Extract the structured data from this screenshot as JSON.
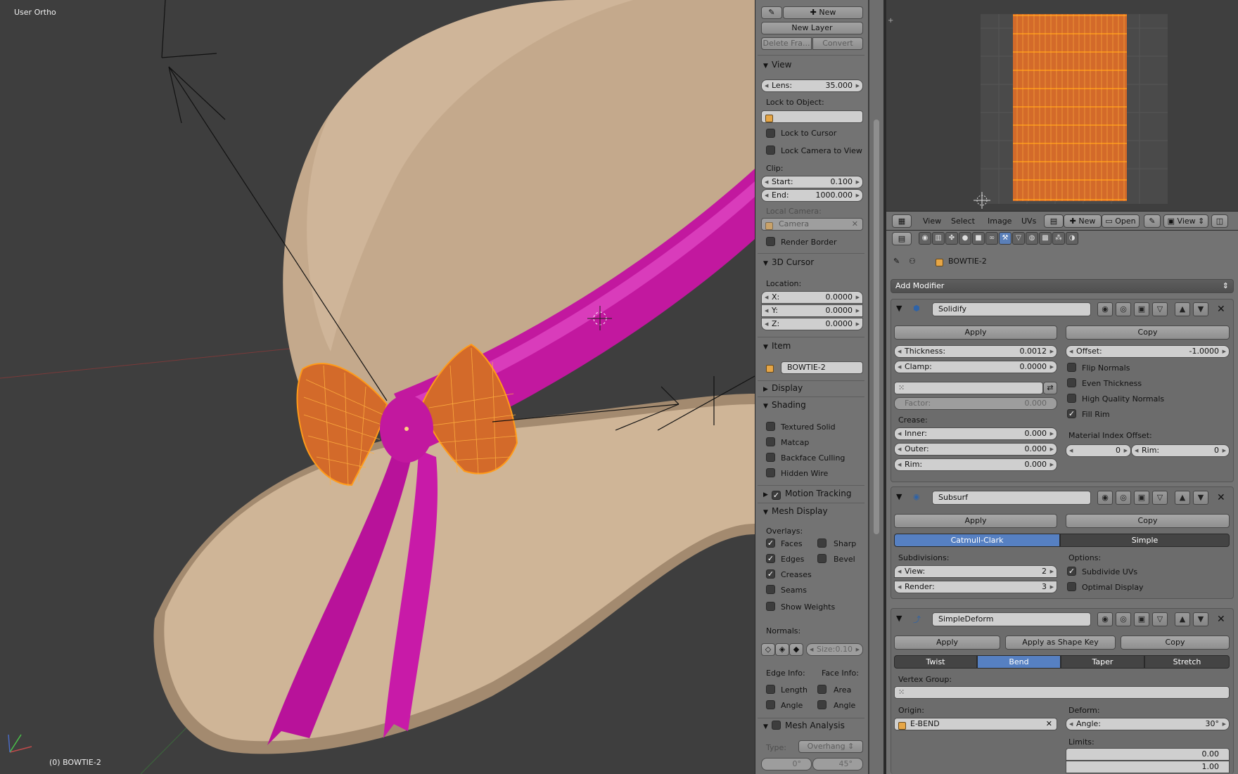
{
  "viewport": {
    "view_name": "User Ortho",
    "object_status": "(0) BOWTIE-2",
    "colors": {
      "hat": "#c7ac8f",
      "ribbon": "#c815a6",
      "wire": "#ff9b1a",
      "bg": "#3e3e3e"
    }
  },
  "npanel": {
    "grease_pencil": {
      "new_label": "New",
      "new_layer_label": "New Layer",
      "delete_frame_label": "Delete Fra...",
      "convert_label": "Convert"
    },
    "view": {
      "header": "View",
      "lens_label": "Lens:",
      "lens_value": "35.000",
      "lock_to_object_label": "Lock to Object:",
      "lock_to_cursor_label": "Lock to Cursor",
      "lock_camera_label": "Lock Camera to View",
      "clip_label": "Clip:",
      "clip_start_label": "Start:",
      "clip_start_value": "0.100",
      "clip_end_label": "End:",
      "clip_end_value": "1000.000",
      "local_camera_label": "Local Camera:",
      "camera_placeholder": "Camera",
      "render_border_label": "Render Border"
    },
    "cursor": {
      "header": "3D Cursor",
      "location_label": "Location:",
      "x_label": "X:",
      "x_value": "0.0000",
      "y_label": "Y:",
      "y_value": "0.0000",
      "z_label": "Z:",
      "z_value": "0.0000"
    },
    "item": {
      "header": "Item",
      "name": "BOWTIE-2"
    },
    "display": {
      "header": "Display"
    },
    "shading": {
      "header": "Shading",
      "textured_solid": "Textured Solid",
      "matcap": "Matcap",
      "backface_culling": "Backface Culling",
      "hidden_wire": "Hidden Wire"
    },
    "motion_tracking": {
      "header": "Motion Tracking"
    },
    "mesh_display": {
      "header": "Mesh Display",
      "overlays_label": "Overlays:",
      "faces": "Faces",
      "sharp": "Sharp",
      "edges": "Edges",
      "bevel": "Bevel",
      "creases": "Creases",
      "seams": "Seams",
      "show_weights": "Show Weights",
      "normals_label": "Normals:",
      "size_label": "Size:",
      "size_value": "0.10",
      "edge_info_label": "Edge Info:",
      "face_info_label": "Face Info:",
      "length": "Length",
      "area": "Area",
      "edge_angle": "Angle",
      "face_angle": "Angle"
    },
    "mesh_analysis": {
      "header": "Mesh Analysis",
      "type_label": "Type:",
      "type_value": "Overhang",
      "min_value": "0°",
      "max_value": "45°"
    }
  },
  "uv_header": {
    "menu_view": "View",
    "menu_select": "Select",
    "menu_image": "Image",
    "menu_uvs": "UVs",
    "new_label": "New",
    "open_label": "Open",
    "view_label": "View"
  },
  "properties": {
    "object_name": "BOWTIE-2",
    "add_modifier_label": "Add Modifier",
    "solidify": {
      "name": "Solidify",
      "apply_label": "Apply",
      "copy_label": "Copy",
      "thickness_label": "Thickness:",
      "thickness_value": "0.0012",
      "offset_label": "Offset:",
      "offset_value": "-1.0000",
      "clamp_label": "Clamp:",
      "clamp_value": "0.0000",
      "flip_normals": "Flip Normals",
      "even_thickness": "Even Thickness",
      "high_quality_normals": "High Quality Normals",
      "fill_rim": "Fill Rim",
      "factor_label": "Factor:",
      "factor_value": "0.000",
      "crease_label": "Crease:",
      "inner_label": "Inner:",
      "inner_value": "0.000",
      "outer_label": "Outer:",
      "outer_value": "0.000",
      "rim_label": "Rim:",
      "rim_value": "0.000",
      "material_offset_label": "Material Index Offset:",
      "material_offset_value": "0",
      "mat_rim_label": "Rim:",
      "mat_rim_value": "0"
    },
    "subsurf": {
      "name": "Subsurf",
      "apply_label": "Apply",
      "copy_label": "Copy",
      "catmull_label": "Catmull-Clark",
      "simple_label": "Simple",
      "subdivisions_label": "Subdivisions:",
      "view_label": "View:",
      "view_value": "2",
      "render_label": "Render:",
      "render_value": "3",
      "options_label": "Options:",
      "subdivide_uvs": "Subdivide UVs",
      "optimal_display": "Optimal Display"
    },
    "simpledeform": {
      "name": "SimpleDeform",
      "apply_label": "Apply",
      "apply_shape_key_label": "Apply as Shape Key",
      "copy_label": "Copy",
      "twist_label": "Twist",
      "bend_label": "Bend",
      "taper_label": "Taper",
      "stretch_label": "Stretch",
      "vertex_group_label": "Vertex Group:",
      "origin_label": "Origin:",
      "origin_value": "E-BEND",
      "deform_label": "Deform:",
      "angle_label": "Angle:",
      "angle_value": "30°",
      "limits_label": "Limits:",
      "limit_min": "0.00",
      "limit_max": "1.00"
    }
  }
}
